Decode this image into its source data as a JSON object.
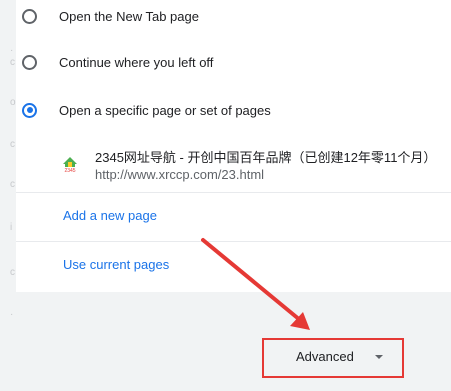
{
  "startup": {
    "options": [
      {
        "label": "Open the New Tab page",
        "checked": false
      },
      {
        "label": "Continue where you left off",
        "checked": false
      },
      {
        "label": "Open a specific page or set of pages",
        "checked": true
      }
    ],
    "pages": [
      {
        "title": "2345网址导航 - 开创中国百年品牌（已创建12年零11个月）",
        "url": "http://www.xrccp.com/23.html",
        "favicon_text": "2345"
      }
    ],
    "add_page_label": "Add a new page",
    "use_current_label": "Use current pages"
  },
  "footer": {
    "advanced_label": "Advanced",
    "advanced_icon": "chevron-down-icon"
  },
  "annotation": {
    "highlight_color": "#e53935"
  }
}
